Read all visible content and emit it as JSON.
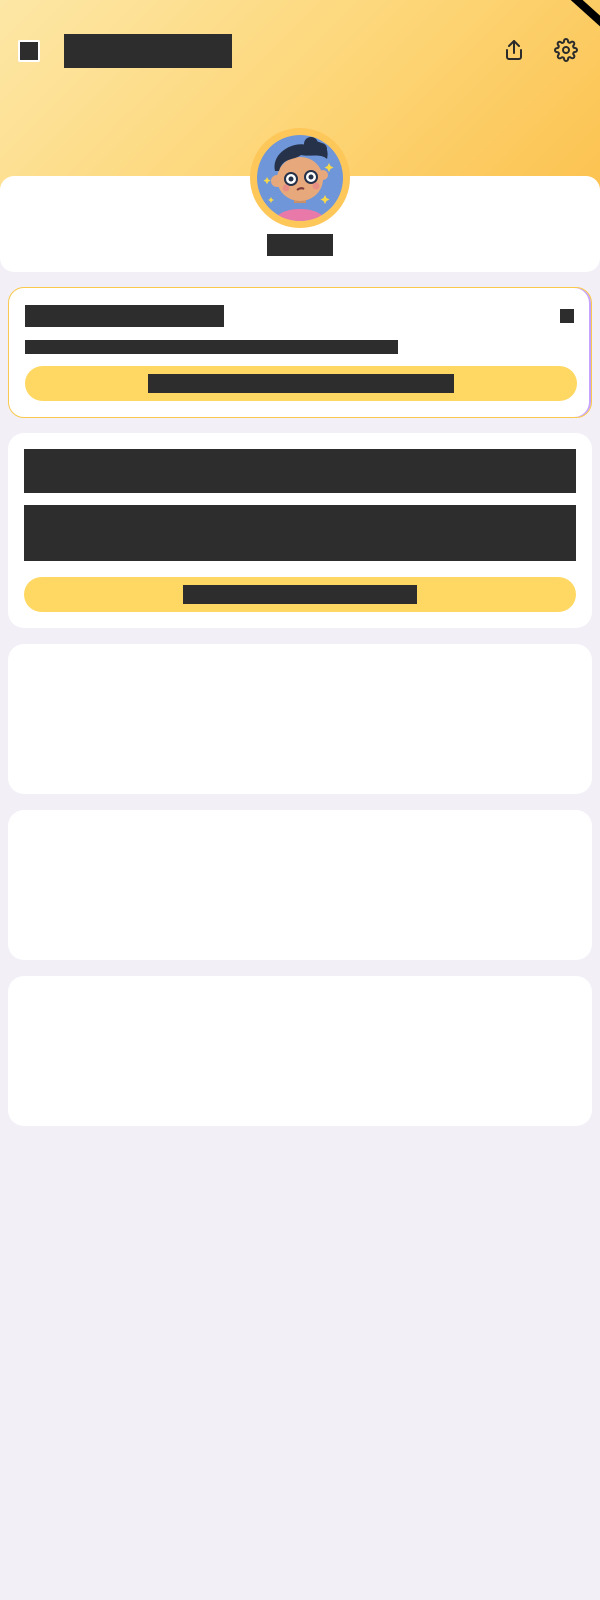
{
  "header": {
    "title": "",
    "back_icon": "back-icon",
    "share_icon": "share-icon",
    "settings_icon": "gear-icon",
    "gradient_colors": [
      "#fde7a6",
      "#fcc24f"
    ]
  },
  "profile": {
    "name": "",
    "avatar_icon": "avatar-illustration"
  },
  "promo_card": {
    "title": "",
    "subtitle": "",
    "button_label": "",
    "close_icon": "close-icon",
    "accent": "#ffd863"
  },
  "info_card": {
    "line1": "",
    "line2": "",
    "button_label": "",
    "accent": "#ffd863"
  },
  "colors": {
    "background": "#f2eff6",
    "card": "#ffffff",
    "button": "#ffd863"
  }
}
